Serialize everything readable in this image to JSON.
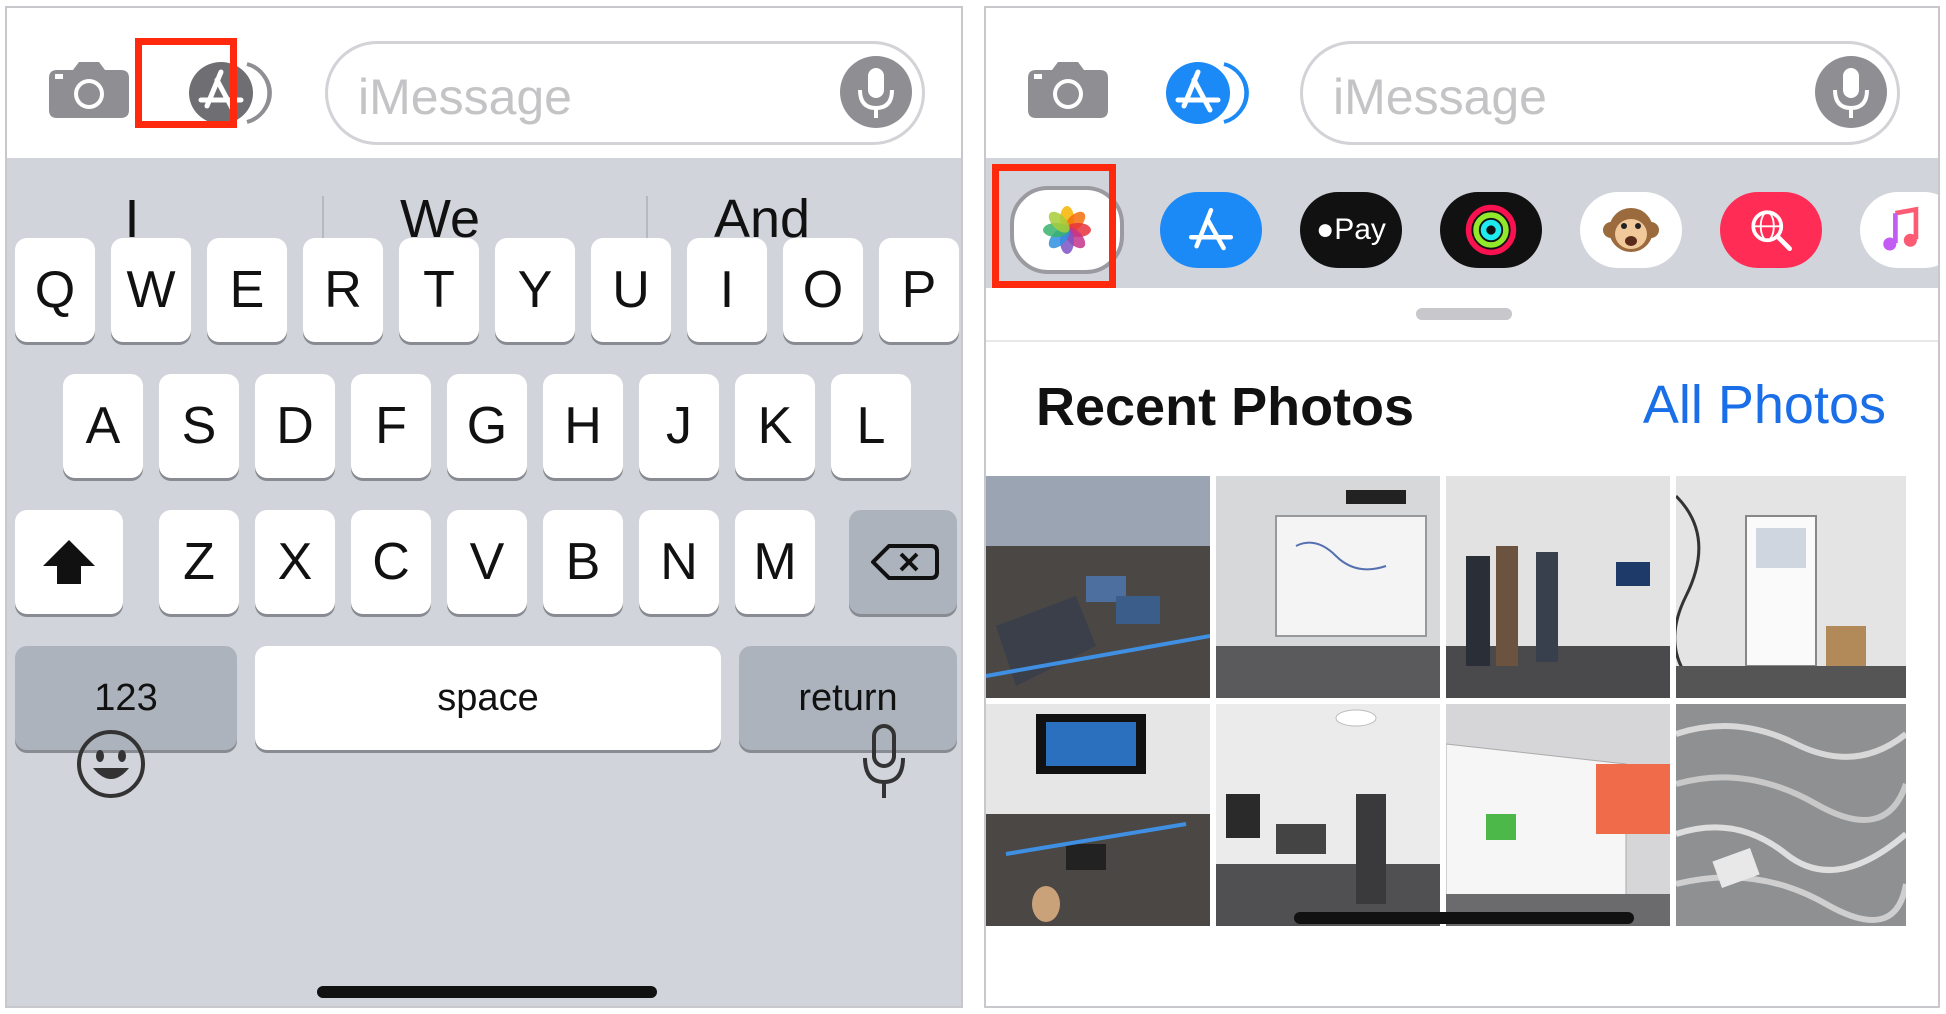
{
  "left": {
    "compose": {
      "placeholder": "iMessage"
    },
    "suggestions": [
      "I",
      "We",
      "And"
    ],
    "keys": {
      "row1": [
        "Q",
        "W",
        "E",
        "R",
        "T",
        "Y",
        "U",
        "I",
        "O",
        "P"
      ],
      "row2": [
        "A",
        "S",
        "D",
        "F",
        "G",
        "H",
        "J",
        "K",
        "L"
      ],
      "row3": [
        "Z",
        "X",
        "C",
        "V",
        "B",
        "N",
        "M"
      ],
      "numbers": "123",
      "space": "space",
      "return": "return"
    }
  },
  "right": {
    "compose": {
      "placeholder": "iMessage"
    },
    "apps": [
      {
        "name": "photos-app"
      },
      {
        "name": "app-store-app"
      },
      {
        "name": "apple-pay-app",
        "label": "Pay"
      },
      {
        "name": "activity-app"
      },
      {
        "name": "animoji-app"
      },
      {
        "name": "images-search-app"
      },
      {
        "name": "music-app"
      }
    ],
    "panel": {
      "title": "Recent Photos",
      "link": "All Photos"
    }
  },
  "colors": {
    "highlight": "#ff2a0e",
    "appstore_blue": "#1b8af6",
    "link_blue": "#1a6fe8",
    "keyboard_bg": "#d1d4db",
    "images_search_red": "#ff2d55"
  }
}
